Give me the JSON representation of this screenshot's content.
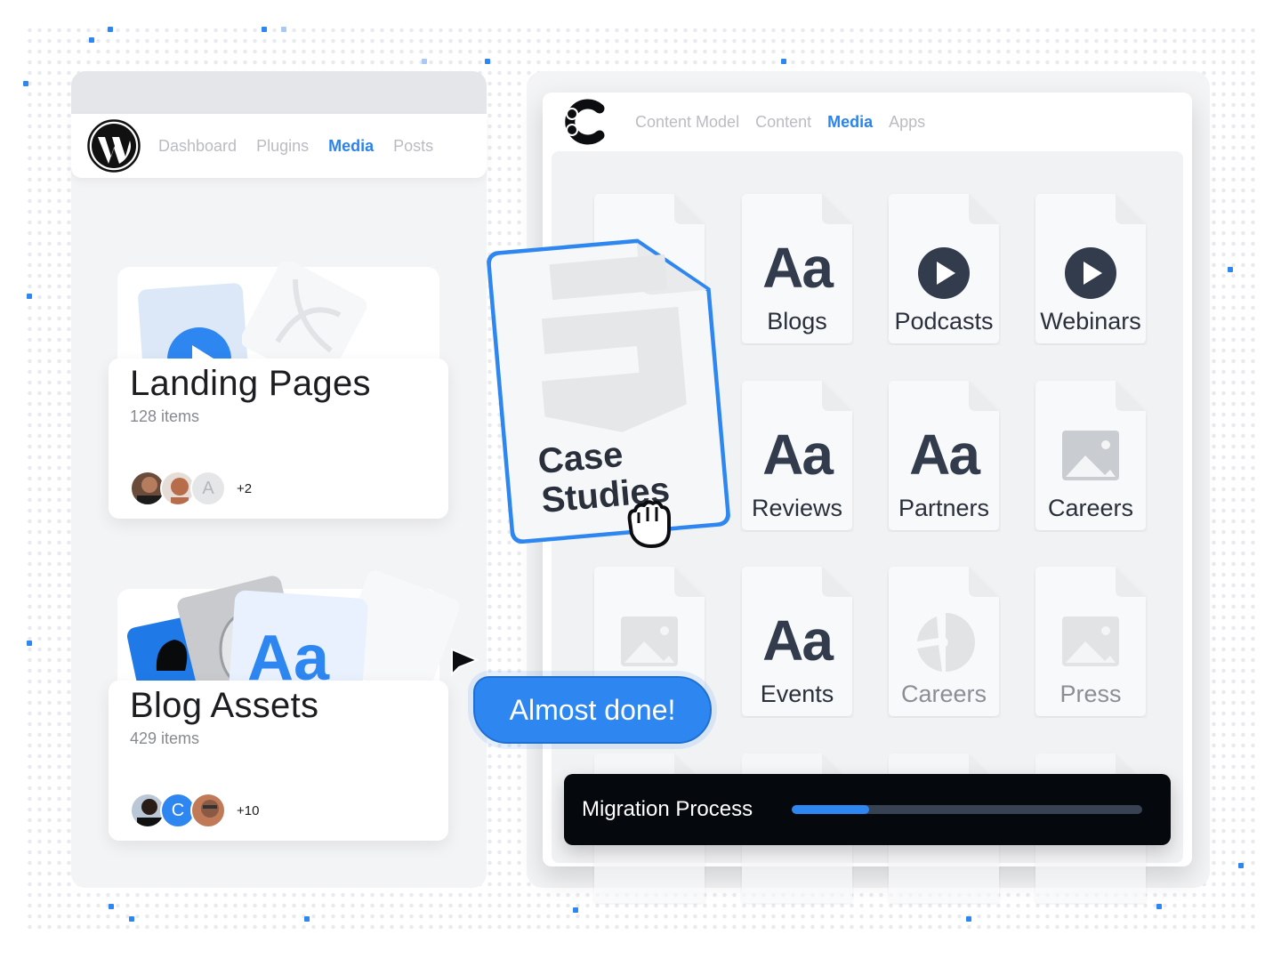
{
  "wordpress": {
    "nav": [
      {
        "label": "Dashboard",
        "active": false
      },
      {
        "label": "Plugins",
        "active": false
      },
      {
        "label": "Media",
        "active": true
      },
      {
        "label": "Posts",
        "active": false
      }
    ],
    "folders": [
      {
        "title": "Landing Pages",
        "count": "128 items",
        "avatar_initial": "A",
        "more": "+2"
      },
      {
        "title": "Blog Assets",
        "count": "429 items",
        "avatar_initial": "C",
        "more": "+10"
      }
    ],
    "blog_card_glyph": "Aa"
  },
  "contentful": {
    "nav": [
      {
        "label": "Content Model",
        "active": false
      },
      {
        "label": "Content",
        "active": false
      },
      {
        "label": "Media",
        "active": true
      },
      {
        "label": "Apps",
        "active": false
      }
    ],
    "tiles": [
      {
        "label": "Blogs",
        "icon": "text-icon",
        "glyph": "Aa"
      },
      {
        "label": "Podcasts",
        "icon": "play-icon"
      },
      {
        "label": "Webinars",
        "icon": "play-icon"
      },
      {
        "label": "Reviews",
        "icon": "text-icon",
        "glyph": "Aa"
      },
      {
        "label": "Partners",
        "icon": "text-icon",
        "glyph": "Aa"
      },
      {
        "label": "Careers",
        "icon": "image-icon"
      },
      {
        "label": "",
        "icon": "image-icon"
      },
      {
        "label": "Events",
        "icon": "text-icon",
        "glyph": "Aa"
      },
      {
        "label": "Careers",
        "icon": "pie-icon"
      },
      {
        "label": "Press",
        "icon": "image-icon"
      }
    ],
    "dragged_card": {
      "label_line1": "Case",
      "label_line2": "Studies"
    }
  },
  "toast": {
    "text": "Almost done!"
  },
  "migration": {
    "label": "Migration Process",
    "progress_percent": 22
  },
  "colors": {
    "accent": "#2e86f0",
    "dark": "#05080c",
    "text": "#2a303b"
  }
}
